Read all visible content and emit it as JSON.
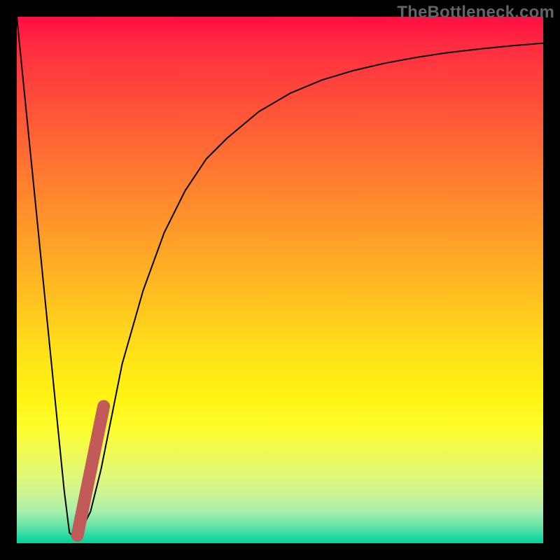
{
  "watermark": "TheBottleneck.com",
  "chart_data": {
    "type": "line",
    "title": "",
    "xlabel": "",
    "ylabel": "",
    "xlim": [
      0,
      100
    ],
    "ylim": [
      0,
      100
    ],
    "series": [
      {
        "name": "curve",
        "x": [
          0,
          3,
          6,
          9,
          10,
          11,
          12,
          14,
          16,
          18,
          20,
          24,
          28,
          32,
          36,
          40,
          46,
          52,
          58,
          64,
          70,
          76,
          82,
          88,
          94,
          100
        ],
        "y": [
          100,
          70,
          40,
          10,
          2,
          1,
          2,
          6,
          14,
          24,
          34,
          48,
          59,
          67,
          73,
          77,
          82,
          85.5,
          88,
          89.8,
          91.2,
          92.3,
          93.2,
          93.9,
          94.5,
          95
        ]
      }
    ],
    "highlight": {
      "name": "highlight-segment",
      "color": "#c15a59",
      "x": [
        11.5,
        16.5
      ],
      "y": [
        1.5,
        26
      ]
    }
  }
}
